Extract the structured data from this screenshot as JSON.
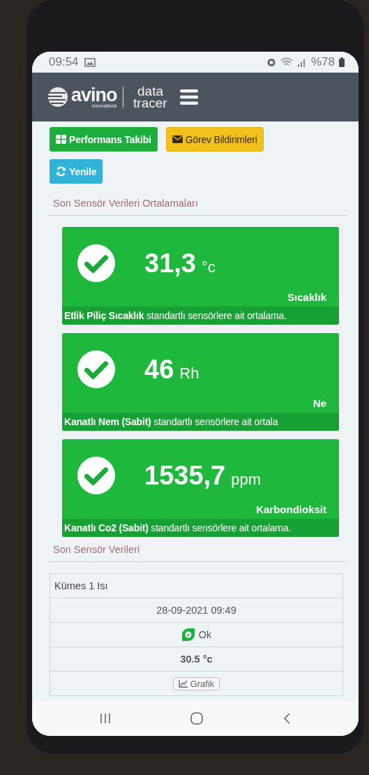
{
  "status_bar": {
    "time": "09:54",
    "battery": "%78"
  },
  "header": {
    "logo": {
      "brand": "avino",
      "tagline": "innovations",
      "product_top": "data",
      "product_bottom": "tracer"
    }
  },
  "buttons": [
    {
      "label": "Performans Takibi",
      "kind": "success"
    },
    {
      "label": "Görev Bildirimleri",
      "kind": "warning"
    },
    {
      "label": "Yenile",
      "kind": "info"
    }
  ],
  "averages": {
    "title": "Son Sensör Verileri Ortalamaları",
    "cards": [
      {
        "value": "31,3",
        "unit": "°c",
        "name": "Sıcaklık",
        "description": "**Etlik Piliç Sıcaklık** standartlı sensörlere ait ortalama."
      },
      {
        "value": "46",
        "unit": "Rh",
        "name": "Ne",
        "description": "**Kanatlı Nem (Sabit)** standartlı sensörlere ait ortala"
      },
      {
        "value": "1535,7",
        "unit": "ppm",
        "name": "Karbondioksit",
        "description": "**Kanatlı Co2 (Sabit)** standartlı sensörlere ait ortalama."
      }
    ]
  },
  "latest": {
    "title": "Son Sensör Verileri",
    "rows": [
      {
        "name": "Kümes 1 Isı",
        "time": "28-09-2021 09:49",
        "status": "Ok",
        "reading": "30.5 °c",
        "button": "Grafik"
      }
    ]
  }
}
